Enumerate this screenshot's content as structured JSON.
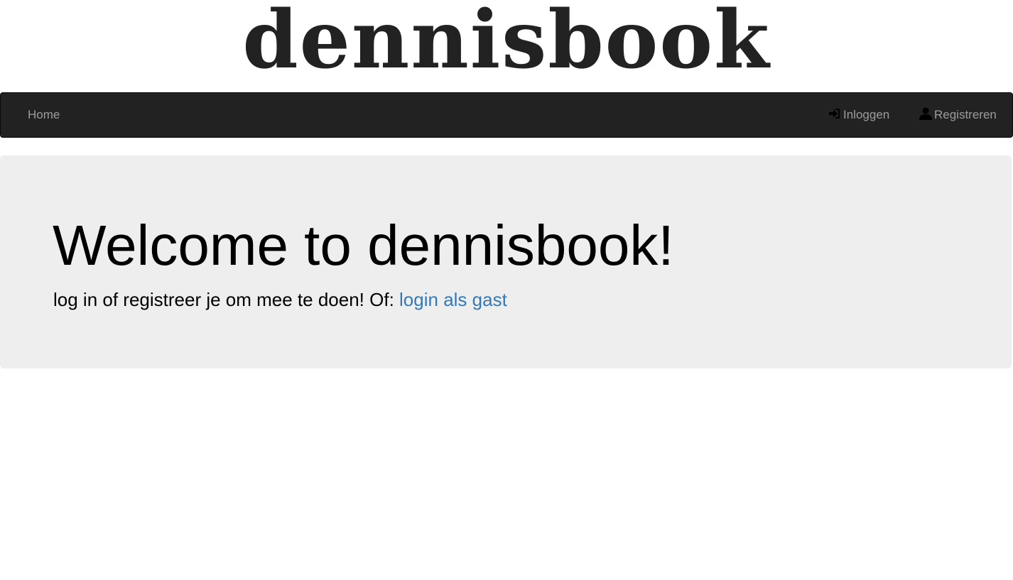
{
  "logo": {
    "text": "dennisbook"
  },
  "navbar": {
    "home_label": "Home",
    "login_label": "Inloggen",
    "login_icon": "log-in-icon",
    "register_label": "Registreren",
    "register_icon": "user-icon",
    "background": "#222222",
    "link_color": "#9d9d9d"
  },
  "jumbotron": {
    "title": "Welcome to dennisbook!",
    "text_prefix": "log in of registreer je om mee te doen! Of: ",
    "guest_link": "login als gast",
    "background": "#eeeeee",
    "link_color": "#337ab7"
  }
}
